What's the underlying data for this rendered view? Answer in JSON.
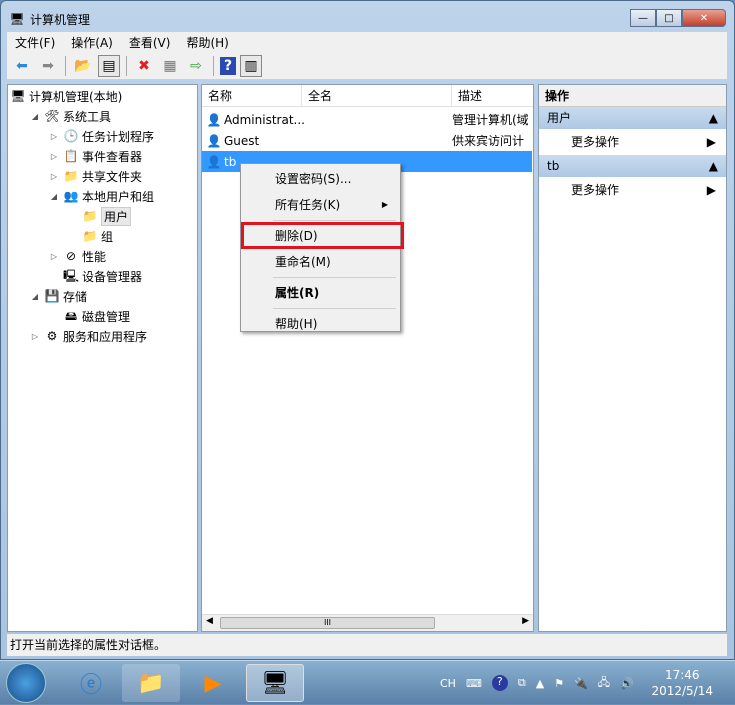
{
  "window": {
    "title": "计算机管理",
    "min": "—",
    "max": "□",
    "close": "✕"
  },
  "menu": [
    "文件(F)",
    "操作(A)",
    "查看(V)",
    "帮助(H)"
  ],
  "tree": [
    {
      "label": "计算机管理(本地)",
      "icon": "computer-mgmt-icon",
      "glyph": "🖥",
      "level": 0,
      "arrow": ""
    },
    {
      "label": "系统工具",
      "icon": "tools-icon",
      "glyph": "🛠",
      "level": 1,
      "arrow": "◢"
    },
    {
      "label": "任务计划程序",
      "icon": "clock-icon",
      "glyph": "🕒",
      "level": 2,
      "arrow": "▷"
    },
    {
      "label": "事件查看器",
      "icon": "event-viewer-icon",
      "glyph": "📋",
      "level": 2,
      "arrow": "▷"
    },
    {
      "label": "共享文件夹",
      "icon": "shared-folder-icon",
      "glyph": "📁",
      "level": 2,
      "arrow": "▷"
    },
    {
      "label": "本地用户和组",
      "icon": "users-icon",
      "glyph": "👥",
      "level": 2,
      "arrow": "◢"
    },
    {
      "label": "用户",
      "icon": "folder-icon",
      "glyph": "📁",
      "level": 3,
      "arrow": "",
      "selected": true
    },
    {
      "label": "组",
      "icon": "folder-icon",
      "glyph": "📁",
      "level": 3,
      "arrow": ""
    },
    {
      "label": "性能",
      "icon": "performance-icon",
      "glyph": "⊘",
      "level": 2,
      "arrow": "▷"
    },
    {
      "label": "设备管理器",
      "icon": "device-manager-icon",
      "glyph": "🖳",
      "level": 2,
      "arrow": ""
    },
    {
      "label": "存储",
      "icon": "storage-icon",
      "glyph": "💾",
      "level": 1,
      "arrow": "◢"
    },
    {
      "label": "磁盘管理",
      "icon": "disk-icon",
      "glyph": "🖴",
      "level": 2,
      "arrow": ""
    },
    {
      "label": "服务和应用程序",
      "icon": "services-icon",
      "glyph": "⚙",
      "level": 1,
      "arrow": "▷"
    }
  ],
  "list": {
    "columns": [
      "名称",
      "全名",
      "描述"
    ],
    "rows": [
      {
        "name": "Administrat...",
        "fullname": "",
        "desc": "管理计算机(域"
      },
      {
        "name": "Guest",
        "fullname": "",
        "desc": "供来宾访问计"
      },
      {
        "name": "tb",
        "fullname": "",
        "desc": "",
        "selected": true
      }
    ],
    "scroll_thumb": "III"
  },
  "actions": {
    "header": "操作",
    "sections": [
      {
        "title": "用户",
        "item": "更多操作"
      },
      {
        "title": "tb",
        "item": "更多操作"
      }
    ]
  },
  "context_menu": [
    "设置密码(S)...",
    "所有任务(K)",
    "删除(D)",
    "重命名(M)",
    "属性(R)",
    "帮助(H)"
  ],
  "status": "打开当前选择的属性对话框。",
  "tray": {
    "lang": "CH",
    "time": "17:46",
    "date": "2012/5/14"
  }
}
